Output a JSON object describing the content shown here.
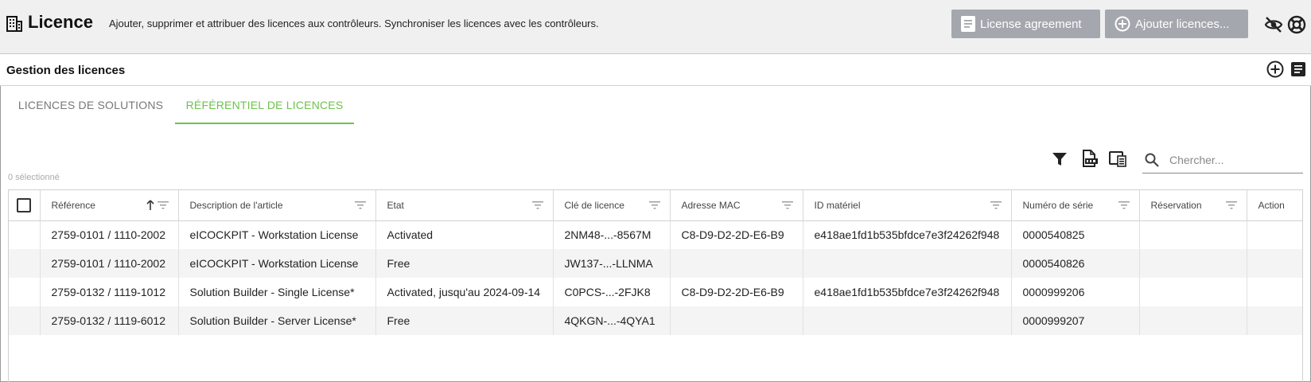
{
  "header": {
    "title": "Licence",
    "subtitle": "Ajouter, supprimer et attribuer des licences aux contrôleurs. Synchroniser les licences avec les contrôleurs.",
    "buttons": {
      "agreement": "License agreement",
      "add": "Ajouter licences..."
    },
    "icons": [
      "building-icon",
      "document-icon",
      "add-circle-icon",
      "eye-off-icon",
      "help-lifebuoy-icon"
    ],
    "button_color": "#a4a7ad"
  },
  "section": {
    "title": "Gestion des licences",
    "icons": [
      "add-circle-icon",
      "notes-icon"
    ]
  },
  "tabs": [
    {
      "label": "LICENCES DE SOLUTIONS",
      "active": false
    },
    {
      "label": "RÉFÉRENTIEL DE LICENCES",
      "active": true
    }
  ],
  "accent_color": "#6cc24a",
  "toolbar": {
    "search_placeholder": "Chercher...",
    "selected_count": "0 sélectionné",
    "icons": [
      "filter-icon",
      "export-csv-icon",
      "columns-icon",
      "search-icon"
    ]
  },
  "table": {
    "columns": [
      "Référence",
      "Description de l'article",
      "Etat",
      "Clé de licence",
      "Adresse MAC",
      "ID matériel",
      "Numéro de série",
      "Réservation",
      "Action"
    ],
    "sorted_column": "Référence",
    "sort_direction": "ascending",
    "rows": [
      [
        "2759-0101 / 1110-2002",
        "eICOCKPIT - Workstation License",
        "Activated",
        "2NM48-...-8567M",
        "C8-D9-D2-2D-E6-B9",
        "e418ae1fd1b535bfdce7e3f24262f948",
        "0000540825",
        "",
        ""
      ],
      [
        "2759-0101 / 1110-2002",
        "eICOCKPIT - Workstation License",
        "Free",
        "JW137-...-LLNMA",
        "",
        "",
        "0000540826",
        "",
        ""
      ],
      [
        "2759-0132 / 1119-1012",
        "Solution Builder - Single License*",
        "Activated, jusqu'au 2024-09-14",
        "C0PCS-...-2FJK8",
        "C8-D9-D2-2D-E6-B9",
        "e418ae1fd1b535bfdce7e3f24262f948",
        "0000999206",
        "",
        ""
      ],
      [
        "2759-0132 / 1119-6012",
        "Solution Builder - Server License*",
        "Free",
        "4QKGN-...-4QYA1",
        "",
        "",
        "0000999207",
        "",
        ""
      ]
    ]
  }
}
